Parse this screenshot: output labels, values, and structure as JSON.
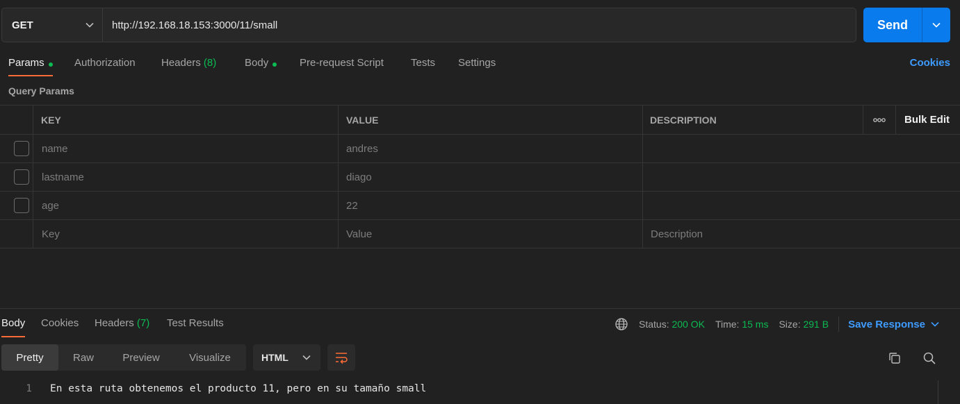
{
  "request": {
    "method": "GET",
    "url": "http://192.168.18.153:3000/11/small",
    "send_label": "Send"
  },
  "request_tabs": {
    "params": "Params",
    "authorization": "Authorization",
    "headers": "Headers",
    "headers_count": "(8)",
    "body": "Body",
    "pre_request": "Pre-request Script",
    "tests": "Tests",
    "settings": "Settings",
    "cookies": "Cookies"
  },
  "query_params": {
    "title": "Query Params",
    "columns": {
      "key": "KEY",
      "value": "VALUE",
      "description": "DESCRIPTION"
    },
    "more_icon": "ooo",
    "bulk_edit": "Bulk Edit",
    "rows": [
      {
        "key": "name",
        "value": "andres",
        "description": ""
      },
      {
        "key": "lastname",
        "value": "diago",
        "description": ""
      },
      {
        "key": "age",
        "value": "22",
        "description": ""
      }
    ],
    "placeholder": {
      "key": "Key",
      "value": "Value",
      "description": "Description"
    }
  },
  "response": {
    "tabs": {
      "body": "Body",
      "cookies": "Cookies",
      "headers": "Headers",
      "headers_count": "(7)",
      "test_results": "Test Results"
    },
    "status_label": "Status:",
    "status_value": "200 OK",
    "time_label": "Time:",
    "time_value": "15 ms",
    "size_label": "Size:",
    "size_value": "291 B",
    "save_response": "Save Response",
    "view_modes": {
      "pretty": "Pretty",
      "raw": "Raw",
      "preview": "Preview",
      "visualize": "Visualize"
    },
    "format": "HTML",
    "lines": [
      {
        "number": "1",
        "text": "En esta ruta obtenemos el producto 11, pero en su tamaño small"
      }
    ]
  },
  "colors": {
    "accent": "#ff6c37",
    "send_button": "#097bed",
    "link": "#3e9bff",
    "success": "#0cbb52"
  }
}
